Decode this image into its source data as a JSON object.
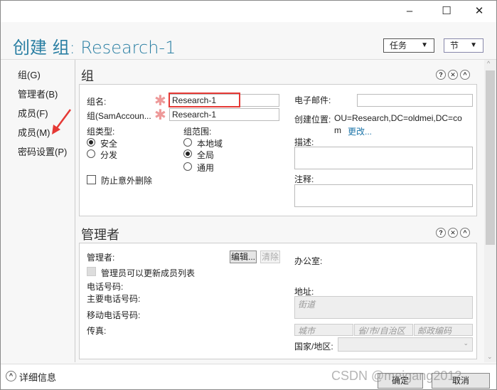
{
  "window": {
    "minimize": "–",
    "maximize": "☐",
    "close": "✕"
  },
  "header": {
    "title": "创建 组: Research-1",
    "tasks_label": "任务",
    "sections_label": "节"
  },
  "nav": {
    "items": [
      {
        "label": "组(G)"
      },
      {
        "label": "管理者(B)"
      },
      {
        "label": "成员(F)"
      },
      {
        "label": "成员(M)"
      },
      {
        "label": "密码设置(P)"
      }
    ]
  },
  "group": {
    "heading": "组",
    "name_label": "组名:",
    "name_value": "Research-1",
    "sam_label": "组(SamAccoun...",
    "sam_value": "Research-1",
    "type_label": "组类型:",
    "type_options": [
      "安全",
      "分发"
    ],
    "scope_label": "组范围:",
    "scope_options": [
      "本地域",
      "全局",
      "通用"
    ],
    "protect_label": "防止意外删除",
    "email_label": "电子邮件:",
    "location_label": "创建位置:",
    "location_value": "OU=Research,DC=oldmei,DC=co",
    "location_value2": "m",
    "change_link": "更改...",
    "desc_label": "描述:",
    "notes_label": "注释:"
  },
  "managed": {
    "heading": "管理者",
    "manager_label": "管理者:",
    "edit_button": "编辑...",
    "clear_button": "清除",
    "can_update_label": "管理员可以更新成员列表",
    "phone_label": "电话号码:",
    "main_phone_label": "主要电话号码:",
    "mobile_label": "移动电话号码:",
    "fax_label": "传真:",
    "office_label": "办公室:",
    "address_label": "地址:",
    "street_placeholder": "街道",
    "city_placeholder": "城市",
    "province_placeholder": "省/市/自治区",
    "zip_placeholder": "邮政编码",
    "country_label": "国家/地区:"
  },
  "footer": {
    "details_label": "详细信息",
    "ok_button": "确定",
    "cancel_button": "取消",
    "watermark": "CSDN @meigang2012"
  },
  "colors": {
    "title": "#2a7fa3",
    "highlight": "#e53935",
    "arrow": "#e53935"
  }
}
